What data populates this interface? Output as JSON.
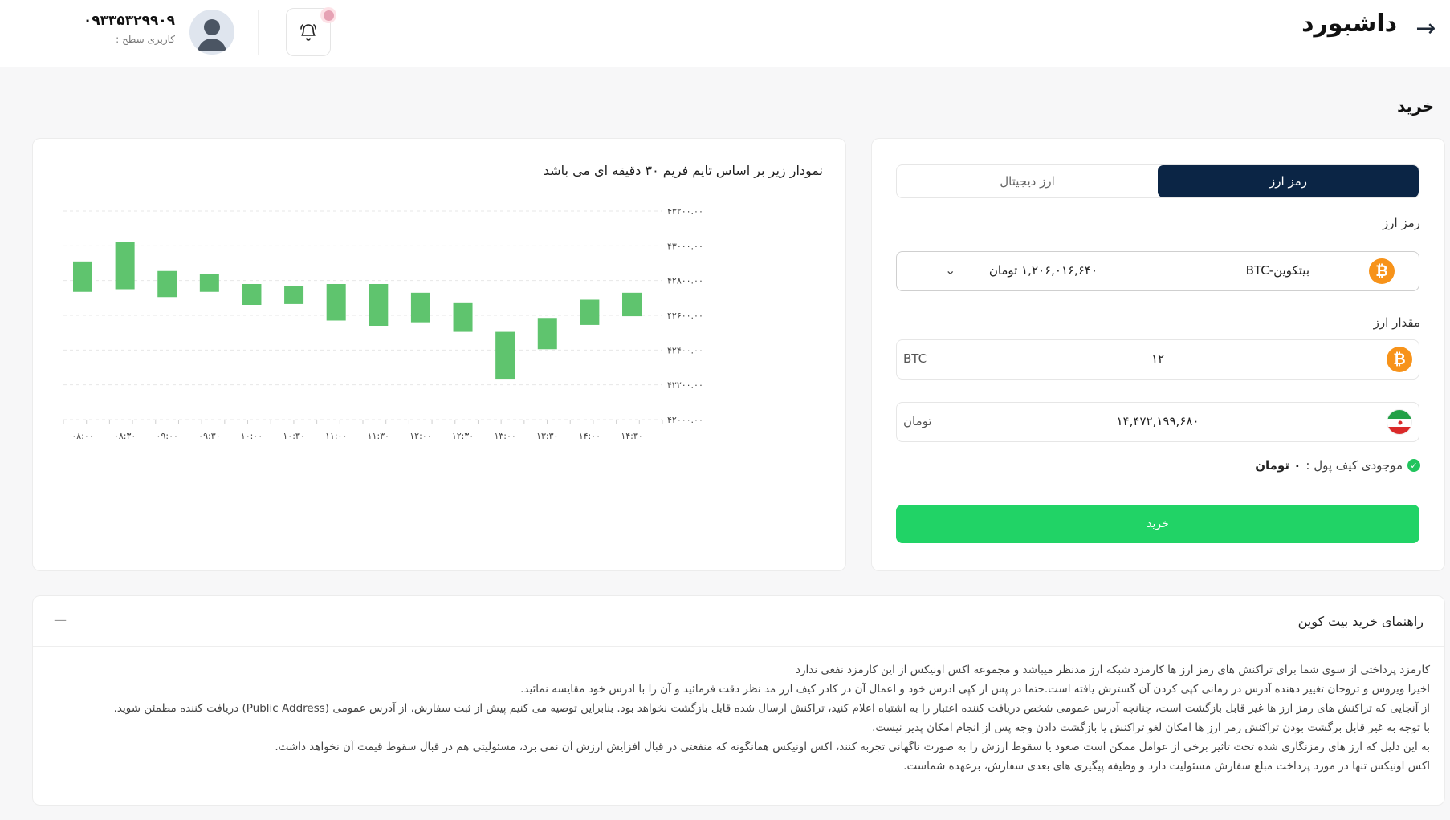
{
  "header": {
    "title": "داشبورد",
    "back_icon": "arrow-right-icon",
    "bell_icon": "bell-icon",
    "user_phone": "۰۹۳۳۵۳۲۹۹۰۹",
    "user_level": "کاربری سطح :"
  },
  "section": {
    "title": "خرید"
  },
  "buy": {
    "tabs": [
      {
        "label": "رمز ارز",
        "active": true
      },
      {
        "label": "ارز دیجیتال",
        "active": false
      }
    ],
    "currency_label": "رمز ارز",
    "selected_coin": "BTC-بیتکوین",
    "selected_price": "۱,۲۰۶,۰۱۶,۶۴۰ تومان",
    "amount_label": "مقدار ارز",
    "amount_value": "۱۲",
    "amount_unit": "BTC",
    "toman_value": "۱۴,۴۷۲,۱۹۹,۶۸۰",
    "toman_unit": "تومان",
    "wallet_label": "موجودی کیف پول :",
    "wallet_value": "۰ تومان",
    "button_label": "خرید",
    "colors": {
      "primary": "#0b2545",
      "buy": "#21d366",
      "btc": "#f7931a"
    }
  },
  "chart_data": {
    "type": "candlestick",
    "title": "نمودار زیر بر اساس تایم فریم ۳۰ دقیقه ای می باشد",
    "x_tick_labels": [
      "۰۸:۰۰",
      "۰۸:۳۰",
      "۰۹:۰۰",
      "۰۹:۳۰",
      "۱۰:۰۰",
      "۱۰:۳۰",
      "۱۱:۰۰",
      "۱۱:۳۰",
      "۱۲:۰۰",
      "۱۲:۳۰",
      "۱۳:۰۰",
      "۱۳:۳۰",
      "۱۴:۰۰",
      "۱۴:۳۰"
    ],
    "y_tick_labels": [
      "۴۳۲۰۰.۰۰",
      "۴۳۰۰۰.۰۰",
      "۴۲۸۰۰.۰۰",
      "۴۲۶۰۰.۰۰",
      "۴۲۴۰۰.۰۰",
      "۴۲۲۰۰.۰۰",
      "۴۲۰۰۰.۰۰"
    ],
    "ylim": [
      42000,
      43200
    ],
    "y_ticks": [
      43200,
      43000,
      42800,
      42600,
      42400,
      42200,
      42000
    ],
    "candles": [
      {
        "x": "08:00",
        "low": 42735,
        "high": 42910
      },
      {
        "x": "08:30",
        "low": 42750,
        "high": 43020
      },
      {
        "x": "09:00",
        "low": 42705,
        "high": 42855
      },
      {
        "x": "09:30",
        "low": 42735,
        "high": 42840
      },
      {
        "x": "10:00",
        "low": 42660,
        "high": 42780
      },
      {
        "x": "10:30",
        "low": 42665,
        "high": 42770
      },
      {
        "x": "11:00",
        "low": 42570,
        "high": 42780
      },
      {
        "x": "11:30",
        "low": 42540,
        "high": 42780
      },
      {
        "x": "12:00",
        "low": 42560,
        "high": 42730
      },
      {
        "x": "12:30",
        "low": 42505,
        "high": 42670
      },
      {
        "x": "13:00",
        "low": 42235,
        "high": 42505
      },
      {
        "x": "13:30",
        "low": 42405,
        "high": 42585
      },
      {
        "x": "14:00",
        "low": 42545,
        "high": 42690
      },
      {
        "x": "14:30",
        "low": 42595,
        "high": 42730
      }
    ],
    "color": "#5fc46e",
    "grid": true
  },
  "guide": {
    "title": "راهنمای خرید بیت کوین",
    "toggle": "—",
    "paragraphs": [
      "کارمزد پرداختی از سوی شما برای تراکنش های رمز ارز ها کارمزد شبکه ارز مدنظر میباشد و مجموعه اکس اونیکس از این کارمزد نفعی ندارد",
      "اخیرا ویروس و تروجان تغییر دهنده آدرس در زمانی کپی کردن آن گسترش یافته است.حتما در پس از کپی ادرس خود و اعمال آن در کادر کیف ارز مد نظر دقت فرمائید و آن را با ادرس خود مقایسه نمائید.",
      "از آنجایی که تراکنش های رمز ارز ها غیر قابل بازگشت است، چنانچه آدرس عمومی شخص دریافت کننده اعتبار را به اشتباه اعلام کنید، تراکنش ارسال شده قابل بازگشت نخواهد بود. بنابراین توصیه می کنیم پیش از ثبت سفارش، از آدرس عمومی (Public Address) دریافت کننده مطمئن شوید.",
      "با توجه به غیر قابل برگشت بودن تراکنش رمز ارز ها امکان لغو تراکنش یا بازگشت دادن وجه پس از انجام امکان پذیر نیست.",
      "به این دلیل که ارز های رمزنگاری شده تحت تاثیر برخی از عوامل ممکن است صعود یا سقوط ارزش را به صورت ناگهانی تجربه کنند، اکس اونیکس همانگونه که منفعتی در قبال افزایش ارزش آن نمی برد، مسئولیتی هم در قبال سقوط قیمت آن نخواهد داشت.",
      "اکس اونیکس تنها در مورد پرداخت مبلغ سفارش مسئولیت دارد و وظیفه پیگیری های بعدی سفارش، برعهده شماست."
    ]
  }
}
